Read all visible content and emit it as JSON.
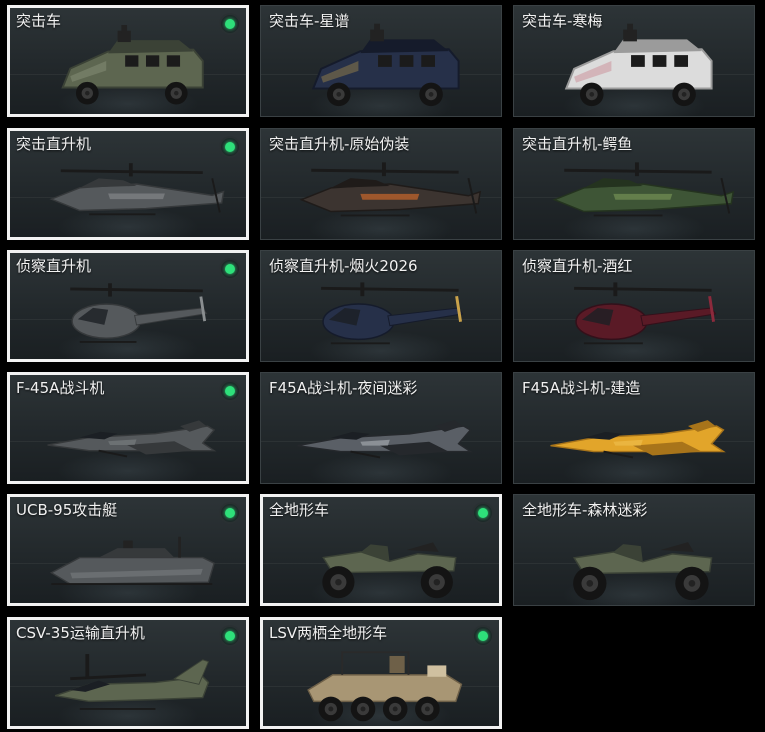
{
  "colors": {
    "equipped": "#2ee07a",
    "selected_border": "#f2f2f2"
  },
  "cards": [
    {
      "label": "突击车",
      "selected": true,
      "equipped": true,
      "shape": "armored-car-icon",
      "palette": "olive"
    },
    {
      "label": "突击车-星谱",
      "selected": false,
      "equipped": false,
      "shape": "armored-car-icon",
      "palette": "navy"
    },
    {
      "label": "突击车-寒梅",
      "selected": false,
      "equipped": false,
      "shape": "armored-car-icon",
      "palette": "white"
    },
    {
      "label": "突击直升机",
      "selected": true,
      "equipped": true,
      "shape": "attack-helicopter-icon",
      "palette": "grey"
    },
    {
      "label": "突击直升机-原始伪装",
      "selected": false,
      "equipped": false,
      "shape": "attack-helicopter-icon",
      "palette": "orange"
    },
    {
      "label": "突击直升机-鳄鱼",
      "selected": false,
      "equipped": false,
      "shape": "attack-helicopter-icon",
      "palette": "green"
    },
    {
      "label": "侦察直升机",
      "selected": true,
      "equipped": true,
      "shape": "scout-helicopter-icon",
      "palette": "grey"
    },
    {
      "label": "侦察直升机-烟火2026",
      "selected": false,
      "equipped": false,
      "shape": "scout-helicopter-icon",
      "palette": "navy"
    },
    {
      "label": "侦察直升机-酒红",
      "selected": false,
      "equipped": false,
      "shape": "scout-helicopter-icon",
      "palette": "wine"
    },
    {
      "label": "F-45A战斗机",
      "selected": true,
      "equipped": true,
      "shape": "fighter-jet-icon",
      "palette": "grey"
    },
    {
      "label": "F45A战斗机-夜间迷彩",
      "selected": false,
      "equipped": false,
      "shape": "fighter-jet-icon",
      "palette": "camo"
    },
    {
      "label": "F45A战斗机-建造",
      "selected": false,
      "equipped": false,
      "shape": "fighter-jet-icon",
      "palette": "yellow"
    },
    {
      "label": "UCB-95攻击艇",
      "selected": true,
      "equipped": true,
      "shape": "attack-boat-icon",
      "palette": "grey"
    },
    {
      "label": "全地形车",
      "selected": true,
      "equipped": true,
      "shape": "atv-icon",
      "palette": "olive"
    },
    {
      "label": "全地形车-森林迷彩",
      "selected": false,
      "equipped": false,
      "shape": "atv-icon",
      "palette": "olive"
    },
    {
      "label": "CSV-35运输直升机",
      "selected": true,
      "equipped": true,
      "shape": "tiltrotor-icon",
      "palette": "olive"
    },
    {
      "label": "LSV两栖全地形车",
      "selected": true,
      "equipped": true,
      "shape": "amphibious-atv-icon",
      "palette": "tan"
    }
  ]
}
